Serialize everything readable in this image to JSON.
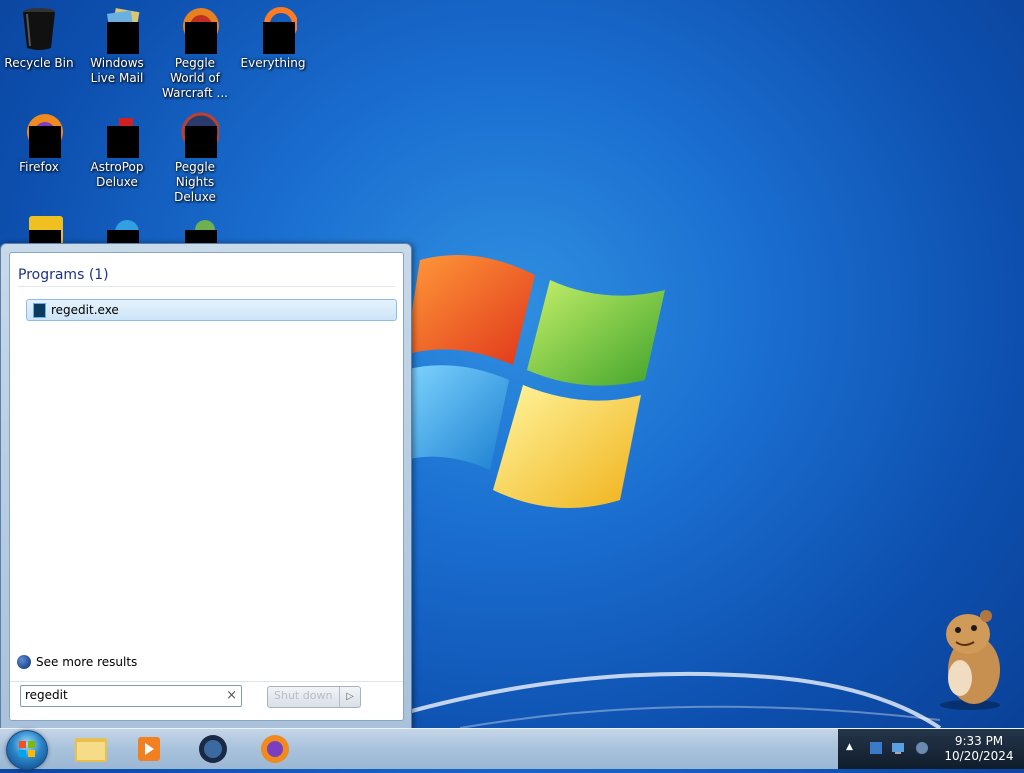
{
  "desktop": {
    "icons": [
      {
        "label": "Recycle Bin"
      },
      {
        "label": "Windows Live Mail"
      },
      {
        "label": "Peggle World of Warcraft ..."
      },
      {
        "label": "Everything"
      },
      {
        "label": "Firefox"
      },
      {
        "label": "AstroPop Deluxe"
      },
      {
        "label": "Peggle Nights Deluxe"
      }
    ]
  },
  "start_menu": {
    "programs_heading": "Programs (1)",
    "results": [
      {
        "label": "regedit.exe",
        "selected": true
      }
    ],
    "see_more": "See more results",
    "search": {
      "value": "regedit",
      "clear_label": "×"
    },
    "shutdown_label": "Shut down",
    "shutdown_arrow": "▷"
  },
  "taskbar": {
    "tray_arrow": "▲",
    "time": "9:33 PM",
    "date": "10/20/2024"
  },
  "colors": {
    "heading": "#1e3287",
    "selection_border": "#8dbde8",
    "tray_bg": "#0f1c2b"
  }
}
